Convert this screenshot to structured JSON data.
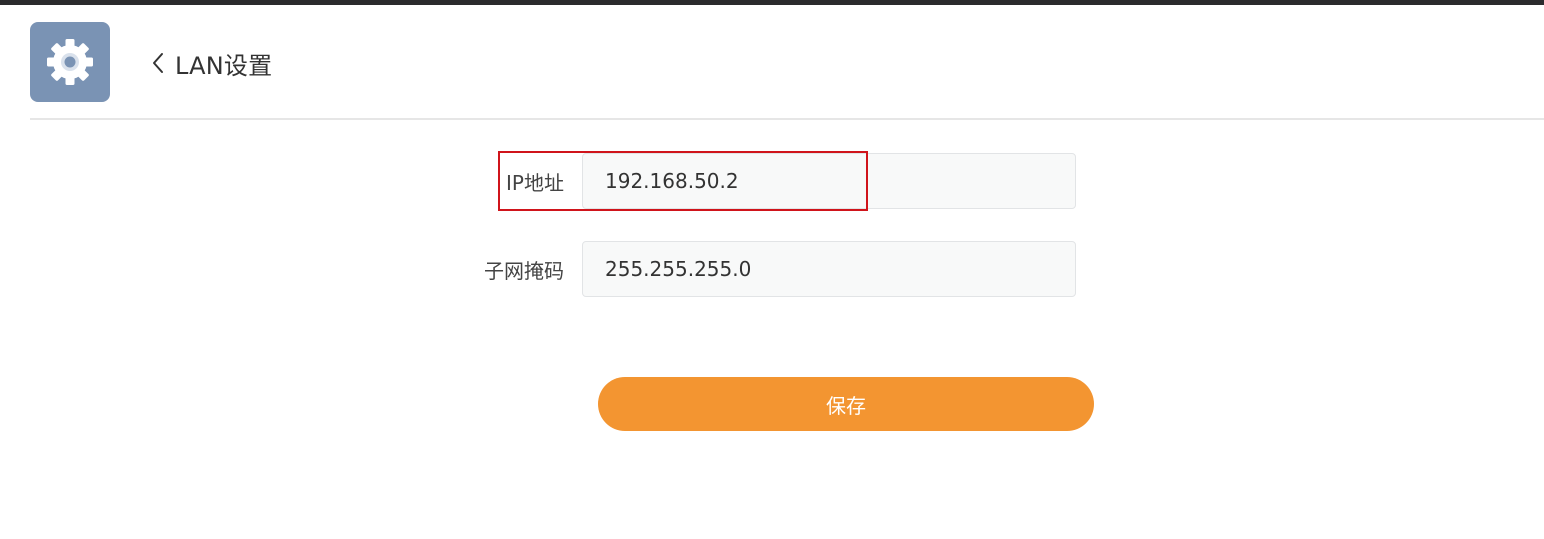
{
  "theme": {
    "icon_bg": "#7a93b4",
    "accent": "#f39531",
    "highlight_border": "#d0141b"
  },
  "header": {
    "app_icon": "gear-icon",
    "back_icon": "chevron-left-icon",
    "title": "LAN设置"
  },
  "form": {
    "ip": {
      "label": "IP地址",
      "value": "192.168.50.2"
    },
    "subnet_mask": {
      "label": "子网掩码",
      "value": "255.255.255.0"
    }
  },
  "actions": {
    "save_label": "保存"
  }
}
